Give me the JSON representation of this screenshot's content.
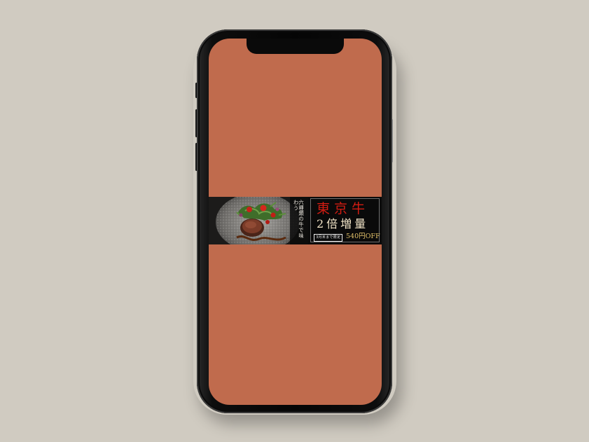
{
  "page": {
    "background": "#d0cbc1"
  },
  "device": {
    "screen_color": "#c06b4d",
    "frame_color": "#0a0a0a"
  },
  "ad_banner": {
    "photo_subject": "beef steak on grey plate with salad and tomatoes",
    "tagline": "六種類の牛で味わう",
    "title": "東京牛",
    "subtitle": "2倍増量",
    "badge": "3月末まで限定",
    "discount": "540円OFF",
    "colors": {
      "title": "#d21c12",
      "discount": "#e2c16a",
      "background": "#0b0b0b"
    }
  }
}
